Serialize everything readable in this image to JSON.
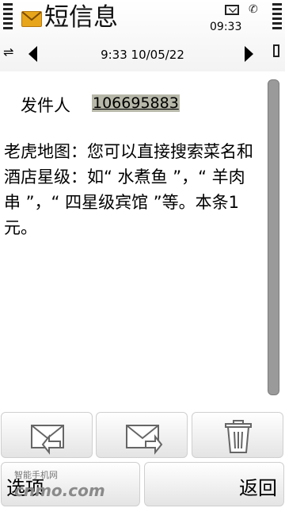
{
  "status": {
    "clock": "09:33"
  },
  "header": {
    "title": "短信息"
  },
  "nav": {
    "datetime": "9:33 10/05/22"
  },
  "message": {
    "sender_label": "发件人",
    "sender_number": "106695883",
    "body": "老虎地图：您可以直接搜索菜名和酒店星级：如“ 水煮鱼 ”，“ 羊肉串 ”，“ 四星级宾馆 ”等。本条1元。"
  },
  "toolbar": {
    "icons": [
      "reply-mail-icon",
      "forward-mail-icon",
      "trash-icon"
    ]
  },
  "softkeys": {
    "left": "选项",
    "right": "返回"
  },
  "watermark": {
    "text": "智能手机网",
    "brand": "cnmo.com"
  }
}
